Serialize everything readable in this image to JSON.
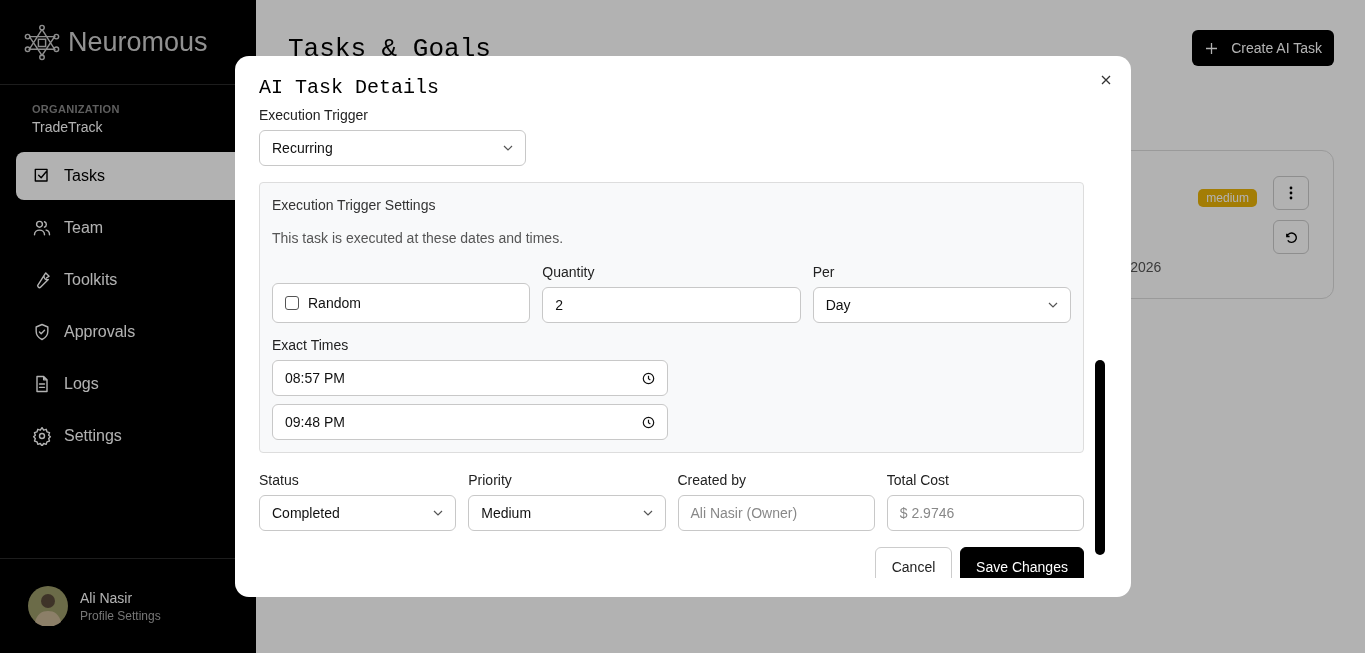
{
  "sidebar": {
    "brand": "Neuromous",
    "org_label": "ORGANIZATION",
    "org_name": "TradeTrack",
    "items": [
      {
        "label": "Tasks",
        "selected": true
      },
      {
        "label": "Team",
        "selected": false
      },
      {
        "label": "Toolkits",
        "selected": false
      },
      {
        "label": "Approvals",
        "selected": false
      },
      {
        "label": "Logs",
        "selected": false
      },
      {
        "label": "Settings",
        "selected": false
      }
    ],
    "user": {
      "name": "Ali Nasir",
      "subtitle": "Profile Settings"
    }
  },
  "page": {
    "title": "Tasks & Goals",
    "create_button": "Create AI Task",
    "card": {
      "date": "2026",
      "badge": "medium"
    }
  },
  "modal": {
    "title": "AI Task Details",
    "trigger": {
      "label": "Execution Trigger",
      "value": "Recurring"
    },
    "settings": {
      "title": "Execution Trigger Settings",
      "description": "This task is executed at these dates and times.",
      "random": {
        "label": "Random",
        "checked": false
      },
      "quantity": {
        "label": "Quantity",
        "value": "2"
      },
      "per": {
        "label": "Per",
        "value": "Day"
      },
      "times_label": "Exact Times",
      "times": [
        "08:57 PM",
        "09:48 PM"
      ]
    },
    "fields": [
      {
        "kind": "select",
        "label": "Status",
        "value": "Completed"
      },
      {
        "kind": "select",
        "label": "Priority",
        "value": "Medium"
      },
      {
        "kind": "readonly",
        "label": "Created by",
        "value": "Ali Nasir (Owner)"
      },
      {
        "kind": "readonly",
        "label": "Total Cost",
        "value": "$ 2.9746"
      }
    ],
    "buttons": [
      {
        "kind": "secondary",
        "label": "Cancel"
      },
      {
        "kind": "primary",
        "label": "Save Changes"
      }
    ]
  }
}
